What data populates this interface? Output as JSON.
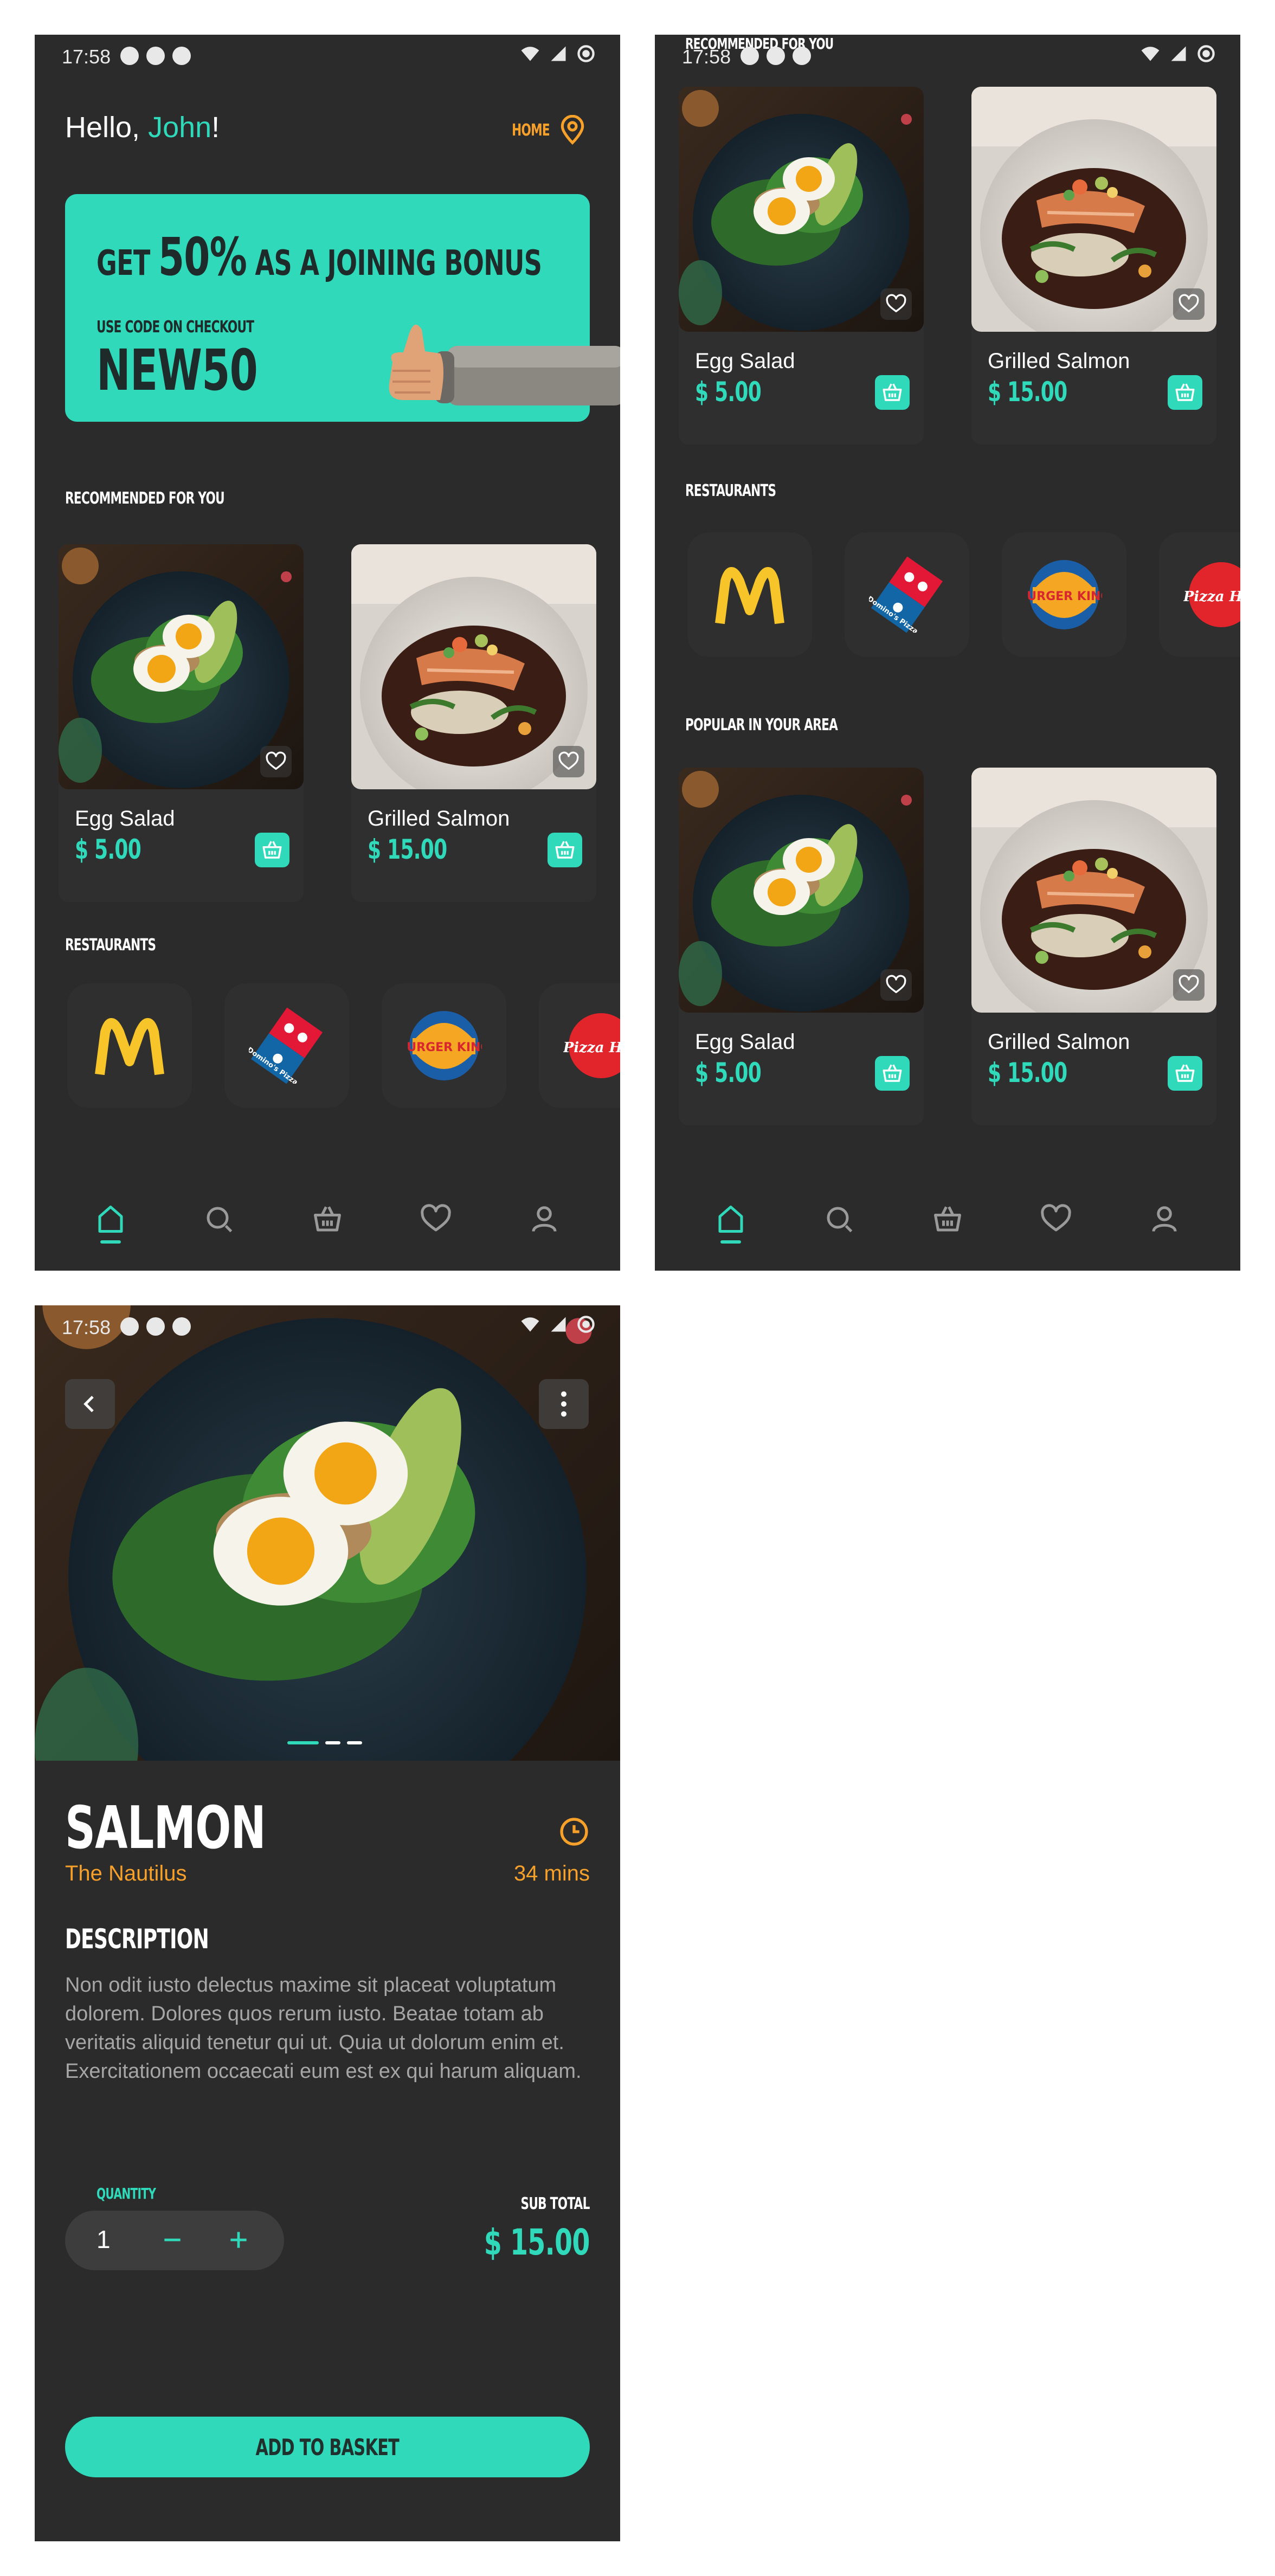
{
  "status": {
    "time": "17:58"
  },
  "home": {
    "greeting_prefix": "Hello, ",
    "user_name": "John",
    "greeting_suffix": "!",
    "location_label": "HOME",
    "promo": {
      "line1_pre": "GET ",
      "line1_big": "50%",
      "line1_post": " AS A JOINING BONUS",
      "line2": "USE CODE ON CHECKOUT",
      "code": "NEW50"
    },
    "recommended_title": "RECOMMENDED FOR YOU",
    "restaurants_title": "RESTAURANTS",
    "popular_title": "POPULAR IN YOUR AREA",
    "items": [
      {
        "title": "Egg Salad",
        "price": "$ 5.00",
        "image": "egg-salad"
      },
      {
        "title": "Grilled Salmon",
        "price": "$ 15.00",
        "image": "grilled-salmon"
      }
    ],
    "restaurants": [
      {
        "name": "McDonald's",
        "logo": "mcdonalds-logo"
      },
      {
        "name": "Domino's Pizza",
        "logo": "dominos-logo",
        "text": "Domino's Pizza"
      },
      {
        "name": "Burger King",
        "logo": "burger-king-logo",
        "text": "BURGER KING"
      },
      {
        "name": "Pizza Hut",
        "logo": "pizza-hut-logo",
        "text": "Pizza Hut"
      }
    ]
  },
  "nav": [
    "home-icon",
    "search-icon",
    "basket-icon",
    "heart-icon",
    "profile-icon"
  ],
  "detail": {
    "title": "SALMON",
    "restaurant": "The Nautilus",
    "time": "34 mins",
    "description_heading": "DESCRIPTION",
    "description": "Non odit iusto delectus maxime sit placeat voluptatum dolorem. Dolores quos rerum iusto. Beatae totam ab veritatis aliquid tenetur qui ut. Quia ut dolorum enim et. Exercitationem occaecati eum est ex qui harum aliquam.",
    "quantity_label": "QUANTITY",
    "quantity": "1",
    "subtotal_label": "SUB TOTAL",
    "subtotal": "$ 15.00",
    "add_button": "ADD TO BASKET"
  },
  "colors": {
    "accent": "#2fd9b9",
    "orange": "#f7a12b",
    "background": "#2b2b2b",
    "card": "#2f2f2f"
  }
}
